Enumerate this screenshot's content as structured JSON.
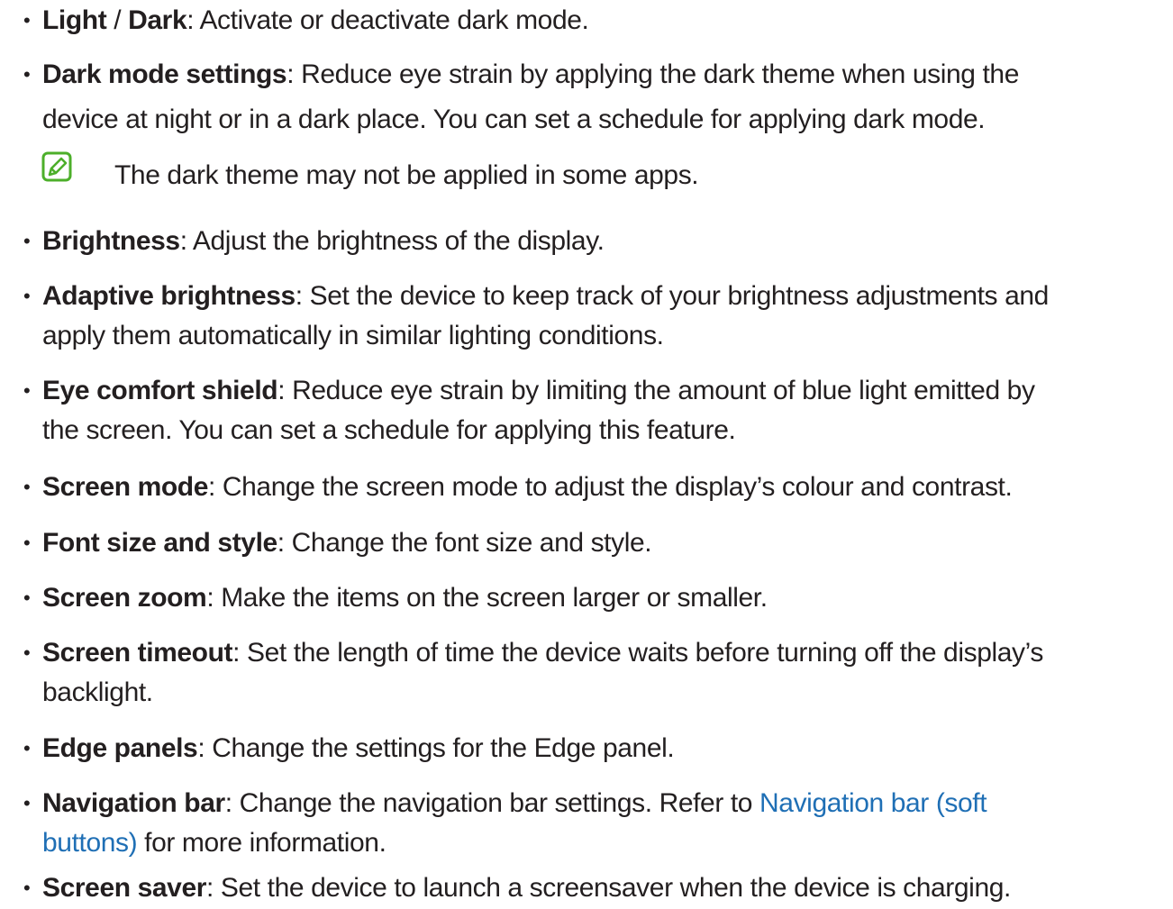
{
  "items": [
    {
      "parts": [
        {
          "t": "Light",
          "b": true
        },
        {
          "t": " / "
        },
        {
          "t": "Dark",
          "b": true
        },
        {
          "t": ": Activate or deactivate dark mode."
        }
      ]
    },
    {
      "lines": [
        [
          {
            "t": "Dark mode settings",
            "b": true
          },
          {
            "t": ": Reduce eye strain by applying the dark theme when using the"
          }
        ],
        [
          {
            "t": "device at night or in a dark place. You can set a schedule for applying dark mode."
          }
        ]
      ]
    },
    {
      "parts": [
        {
          "t": "Brightness",
          "b": true
        },
        {
          "t": ": Adjust the brightness of the display."
        }
      ]
    },
    {
      "lines": [
        [
          {
            "t": "Adaptive brightness",
            "b": true
          },
          {
            "t": ": Set the device to keep track of your brightness adjustments and"
          }
        ],
        [
          {
            "t": "apply them automatically in similar lighting conditions."
          }
        ]
      ]
    },
    {
      "lines": [
        [
          {
            "t": "Eye comfort shield",
            "b": true
          },
          {
            "t": ": Reduce eye strain by limiting the amount of blue light emitted by"
          }
        ],
        [
          {
            "t": "the screen. You can set a schedule for applying this feature."
          }
        ]
      ]
    },
    {
      "parts": [
        {
          "t": "Screen mode",
          "b": true
        },
        {
          "t": ": Change the screen mode to adjust the display’s colour and contrast."
        }
      ]
    },
    {
      "parts": [
        {
          "t": "Font size and style",
          "b": true
        },
        {
          "t": ": Change the font size and style."
        }
      ]
    },
    {
      "parts": [
        {
          "t": "Screen zoom",
          "b": true
        },
        {
          "t": ": Make the items on the screen larger or smaller."
        }
      ]
    },
    {
      "lines": [
        [
          {
            "t": "Screen timeout",
            "b": true
          },
          {
            "t": ": Set the length of time the device waits before turning off the display’s"
          }
        ],
        [
          {
            "t": "backlight."
          }
        ]
      ]
    },
    {
      "parts": [
        {
          "t": "Edge panels",
          "b": true
        },
        {
          "t": ": Change the settings for the Edge panel."
        }
      ]
    },
    {
      "lines": [
        [
          {
            "t": "Navigation bar",
            "b": true
          },
          {
            "t": ": Change the navigation bar settings. Refer to "
          },
          {
            "t": "Navigation bar (soft",
            "link": true
          }
        ],
        [
          {
            "t": "buttons)",
            "link": true
          },
          {
            "t": " for more information."
          }
        ]
      ]
    },
    {
      "parts": [
        {
          "t": "Screen saver",
          "b": true
        },
        {
          "t": ": Set the device to launch a screensaver when the device is charging."
        }
      ]
    }
  ],
  "note": {
    "icon": "note-pencil-icon",
    "text": "The dark theme may not be applied in some apps."
  },
  "bullet_char": "•",
  "colors": {
    "text": "#231f20",
    "link": "#1f6fb5",
    "note_icon": "#4caf2a"
  }
}
